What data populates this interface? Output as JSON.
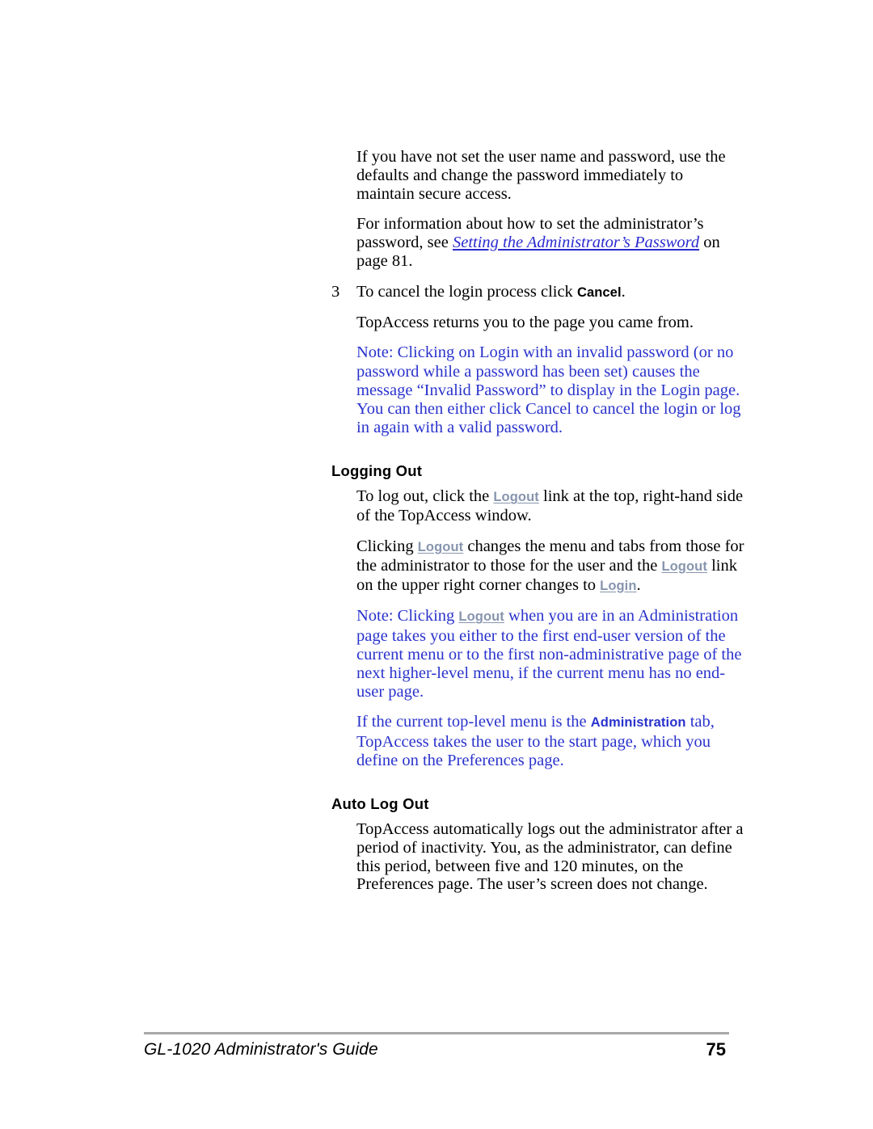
{
  "document": {
    "title": "GL-1020 Administrator's Guide",
    "page_number": "75"
  },
  "colors": {
    "note_blue": "#2a33cc",
    "ui_link_grey_blue": "#8795ae",
    "xref_blue": "#2a2ad0",
    "rule_grey": "#a8a8a8",
    "body_text": "#000000"
  },
  "content": {
    "paragraph_1": "If you have not set the user name and password, use the defaults and change the password immediately to maintain secure access.",
    "paragraph_2_part1": "For information about how to set the administrator’s password, see ",
    "paragraph_2_xref": "Setting the Administrator’s Password",
    "paragraph_2_part2": " on page 81.",
    "step_3": {
      "number": "3",
      "text_part1": "To cancel the login process click ",
      "ui_label": "Cancel",
      "text_part2": "."
    },
    "paragraph_3": "TopAccess returns you to the page you came from.",
    "note_1": "Note: Clicking on Login with an invalid password (or no password while a password has been set) causes the message “Invalid Password” to display in the Login page. You can then either click Cancel to cancel the login or log in again with a valid password.",
    "heading_logging_out": "Logging Out",
    "paragraph_4_part1": "To log out, click the ",
    "paragraph_4_link": "Logout",
    "paragraph_4_part2": " link at the top, right-hand side of the TopAccess window.",
    "paragraph_5_part1": "Clicking ",
    "paragraph_5_link1": "Logout",
    "paragraph_5_part2": " changes the menu and tabs from those for the administrator to those for the user and the ",
    "paragraph_5_link2": "Logout",
    "paragraph_5_part3": " link on the upper right corner changes to ",
    "paragraph_5_link3": "Login",
    "paragraph_5_part4": ".",
    "note_2_part1": "Note: Clicking ",
    "note_2_link": "Logout",
    "note_2_part2": " when you are in an Administration page takes you either to the first end-user version of the current menu or to the first non-administrative page of the next higher-level menu, if the current menu has no end-user page.",
    "note_3_part1": "If the current top-level menu is the ",
    "note_3_ui_label": "Administration",
    "note_3_part2": " tab, TopAccess takes the user to the start page, which you define on the Preferences page.",
    "heading_auto_log_out": "Auto Log Out",
    "paragraph_6": "TopAccess automatically logs out the administrator after a period of inactivity. You, as the administrator, can define this period, between five and 120 minutes, on the Preferences page. The user’s screen does not change."
  }
}
